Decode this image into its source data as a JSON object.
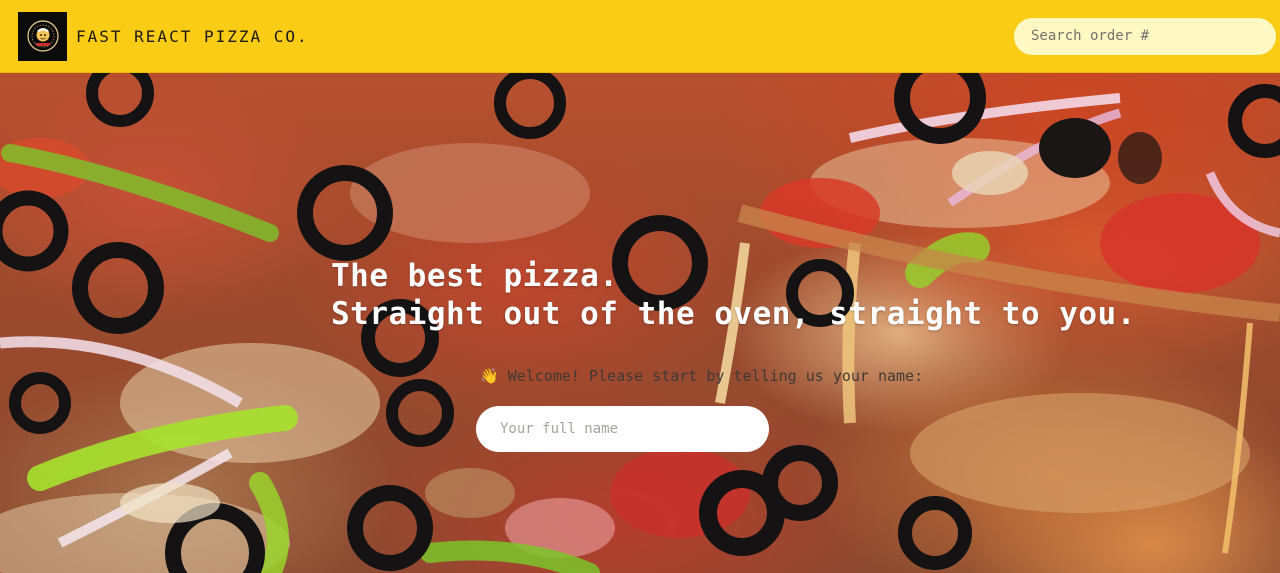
{
  "header": {
    "brand": "Fast React Pizza Co.",
    "search_placeholder": "Search order #"
  },
  "hero": {
    "title_line1": "The best pizza.",
    "title_line2": "Straight out of the oven, straight to you.",
    "welcome_icon": "waving-hand-icon",
    "welcome_text": "👋 Welcome! Please start by telling us your name:",
    "name_placeholder": "Your full name"
  },
  "colors": {
    "header_bg": "#FACC15",
    "search_bg": "#FEF9C3",
    "title": "#FFFFFF",
    "input_bg": "#FFFFFF"
  }
}
